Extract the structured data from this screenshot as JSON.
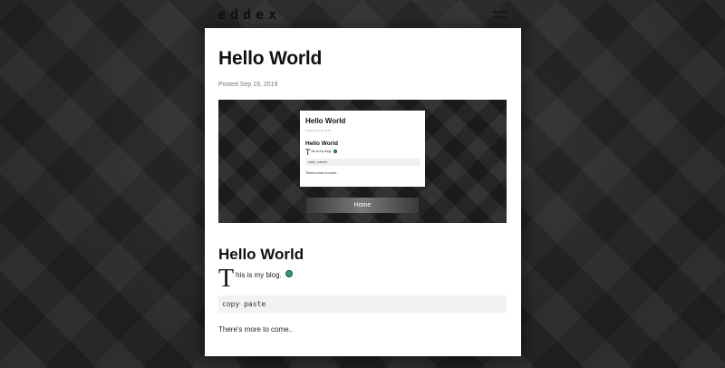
{
  "header": {
    "brand": "eddex"
  },
  "post": {
    "title": "Hello World",
    "meta": "Posted Sep 19, 2019",
    "screenshot": {
      "title": "Hello World",
      "meta": "Posted Sep 19, 2019",
      "heading": "Hello World",
      "dropcap": "T",
      "text": "his is my blog.",
      "code": "copy paste",
      "more": "There's more to come..",
      "home_label": "Home"
    },
    "heading": "Hello World",
    "dropcap": "T",
    "body_text": "his is my blog.",
    "code": "copy paste",
    "more": "There's more to come..",
    "dot_color": "#2a9d6a"
  }
}
